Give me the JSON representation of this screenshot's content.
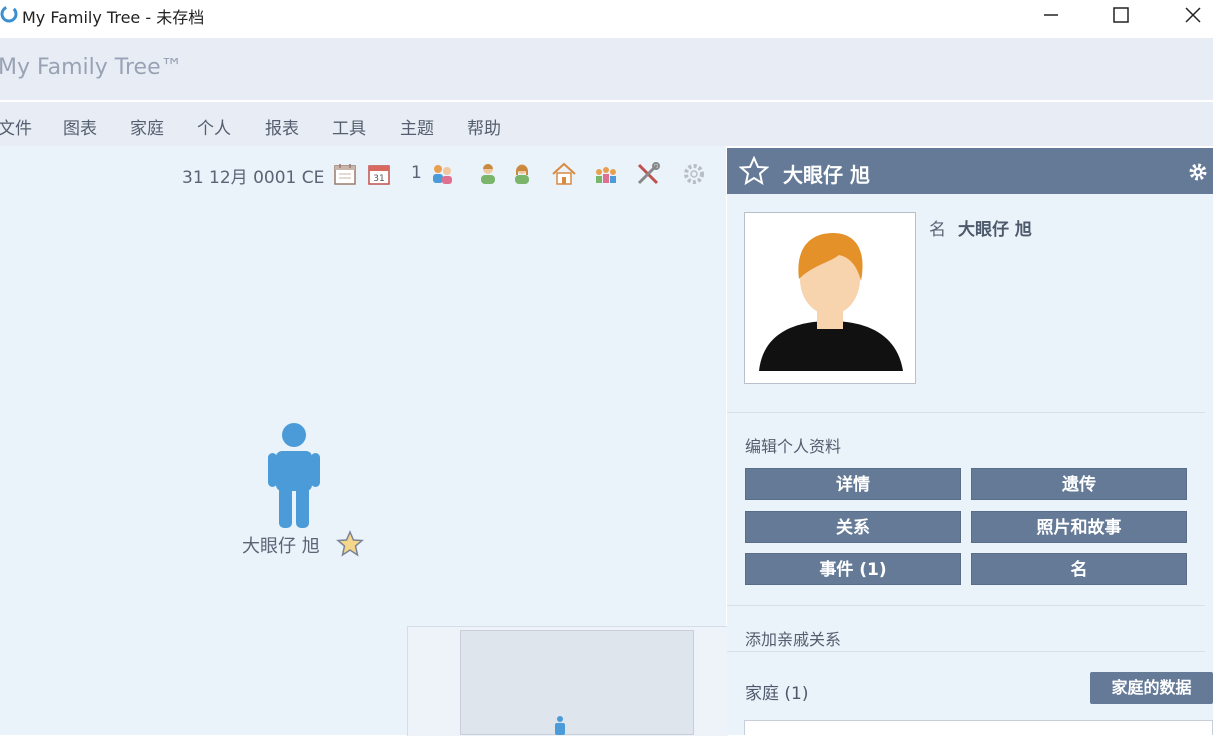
{
  "window": {
    "title": "My Family Tree - 未存档"
  },
  "brand": {
    "name": "My Family Tree™"
  },
  "menu": [
    {
      "label": "文件"
    },
    {
      "label": "图表"
    },
    {
      "label": "家庭"
    },
    {
      "label": "个人"
    },
    {
      "label": "报表"
    },
    {
      "label": "工具"
    },
    {
      "label": "主题"
    },
    {
      "label": "帮助"
    }
  ],
  "toolbar": {
    "date": "31 12月 0001 CE",
    "calendar_day": "31",
    "count": "1",
    "icons": [
      "calendar-icon",
      "calendar-day-icon",
      "people-count-icon",
      "add-male-icon",
      "add-female-icon",
      "home-icon",
      "family-icon",
      "tools-icon",
      "settings-icon"
    ]
  },
  "tree": {
    "person_name": "大眼仔 旭"
  },
  "panel": {
    "header_name": "大眼仔 旭",
    "name_label": "名",
    "name_value": "大眼仔 旭",
    "edit_section_title": "编辑个人资料",
    "buttons": {
      "details": "详情",
      "genetics": "遗传",
      "relations": "关系",
      "photos": "照片和故事",
      "events": "事件 (1)",
      "names": "名"
    },
    "add_relatives_title": "添加亲戚关系",
    "family_label": "家庭 (1)",
    "family_data_button": "家庭的数据"
  },
  "colors": {
    "accent": "#647a96",
    "canvas": "#eaf2fa",
    "person": "#4a9bd8"
  }
}
